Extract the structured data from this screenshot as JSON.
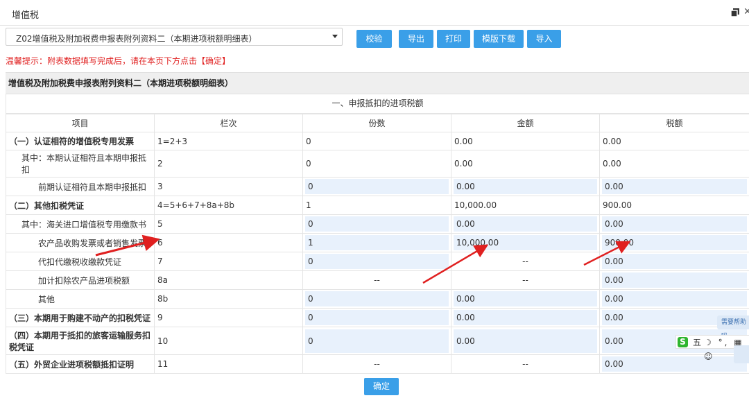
{
  "window": {
    "title": "增值税"
  },
  "toolbar": {
    "select_value": "Z02增值税及附加税费申报表附列资料二（本期进项税额明细表）",
    "buttons": [
      {
        "label": "校验"
      },
      {
        "label": "导出"
      },
      {
        "label": "打印"
      },
      {
        "label": "模版下载"
      },
      {
        "label": "导入"
      }
    ]
  },
  "tip": "温馨提示：附表数据填写完成后，请在本页下方点击【确定】",
  "sheet": {
    "title": "增值税及附加税费申报表附列资料二（本期进项税额明细表）",
    "section_title": "一、申报抵扣的进项税额",
    "headers": [
      "项目",
      "栏次",
      "份数",
      "金额",
      "税额"
    ],
    "rows": [
      {
        "item": "（一）认证相符的增值税专用发票",
        "code": "1=2+3",
        "copies": "0",
        "amount": "0.00",
        "tax": "0.00"
      },
      {
        "item": "其中：本期认证相符且本期申报抵扣",
        "code": "2",
        "copies": "0",
        "amount": "0.00",
        "tax": "0.00"
      },
      {
        "item": "前期认证相符且本期申报抵扣",
        "code": "3",
        "copies": "0",
        "amount": "0.00",
        "tax": "0.00"
      },
      {
        "item": "（二）其他扣税凭证",
        "code": "4=5+6+7+8a+8b",
        "copies": "1",
        "amount": "10,000.00",
        "tax": "900.00"
      },
      {
        "item": "其中：海关进口增值税专用缴款书",
        "code": "5",
        "copies": "0",
        "amount": "0.00",
        "tax": "0.00"
      },
      {
        "item": "农产品收购发票或者销售发票",
        "code": "6",
        "copies": "1",
        "amount": "10,000.00",
        "tax": "900.00"
      },
      {
        "item": "代扣代缴税收缴款凭证",
        "code": "7",
        "copies": "0",
        "amount": "--",
        "tax": "0.00"
      },
      {
        "item": "加计扣除农产品进项税额",
        "code": "8a",
        "copies": "--",
        "amount": "--",
        "tax": "0.00"
      },
      {
        "item": "其他",
        "code": "8b",
        "copies": "0",
        "amount": "0.00",
        "tax": "0.00"
      },
      {
        "item": "（三）本期用于购建不动产的扣税凭证",
        "code": "9",
        "copies": "0",
        "amount": "0.00",
        "tax": "0.00"
      },
      {
        "item": "（四）本期用于抵扣的旅客运输服务扣税凭证",
        "code": "10",
        "copies": "0",
        "amount": "0.00",
        "tax": "0.00"
      },
      {
        "item": "（五）外贸企业进项税额抵扣证明",
        "code": "11",
        "copies": "--",
        "amount": "--",
        "tax": "0.00"
      }
    ]
  },
  "confirm_label": "确定",
  "overlay": {
    "help_text": "需要帮助吗",
    "ime_lang": "五",
    "ime_glyphs": "☽ °, ▦ ☺"
  },
  "colors": {
    "accent": "#3a9fe8",
    "tip": "#e02020",
    "input_bg": "#e8f1fc",
    "arrow": "#e02020"
  }
}
